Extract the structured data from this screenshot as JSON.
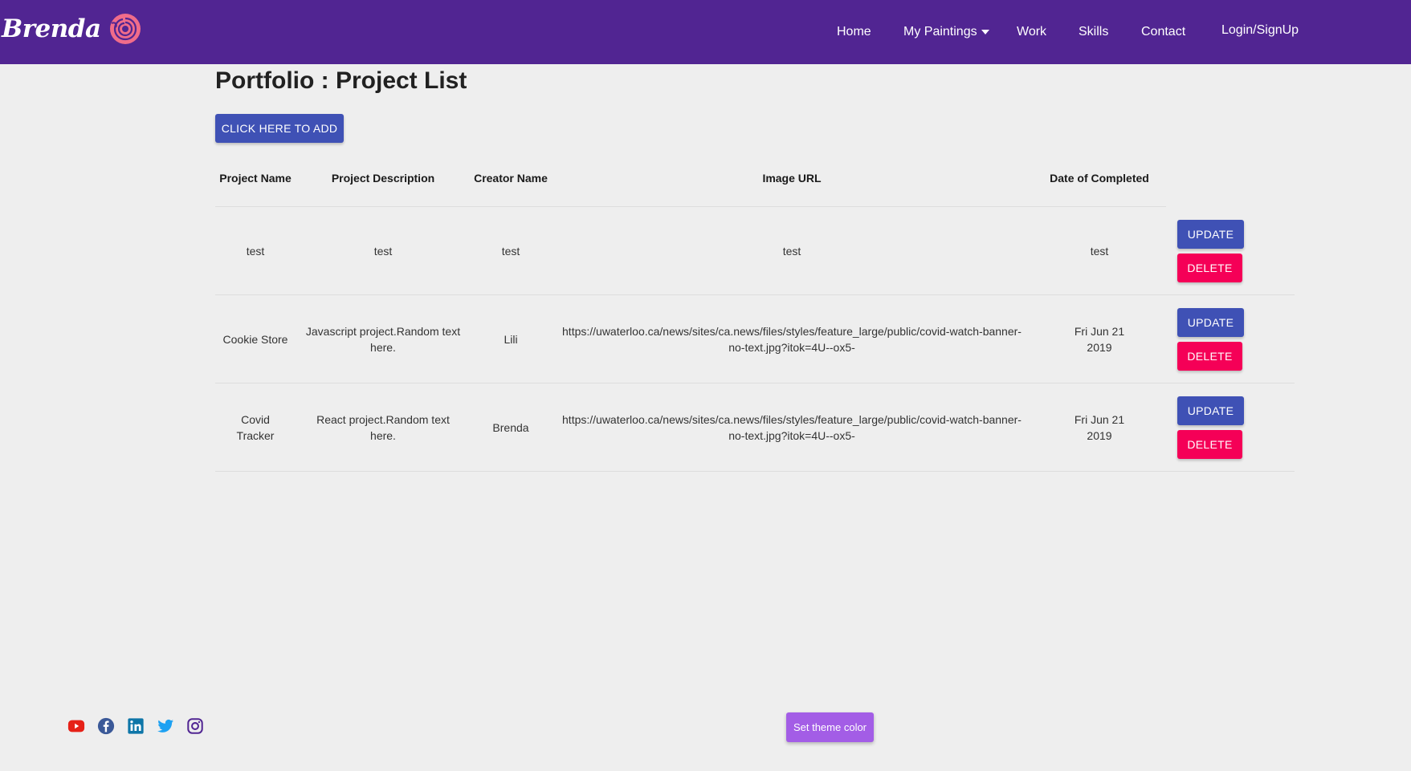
{
  "brand": {
    "name": "Brenda"
  },
  "nav": {
    "home": "Home",
    "paintings": "My Paintings",
    "work": "Work",
    "skills": "Skills",
    "contact": "Contact",
    "login": "Login/SignUp"
  },
  "page": {
    "title": "Portfolio : Project List",
    "add_button": "CLICK HERE TO ADD"
  },
  "table": {
    "headers": {
      "name": "Project Name",
      "description": "Project Description",
      "creator": "Creator Name",
      "image_url": "Image URL",
      "date": "Date of Completed"
    },
    "rows": [
      {
        "name": "test",
        "description": "test",
        "creator": "test",
        "image_url": "test",
        "date": "test",
        "update": "UPDATE",
        "delete": "DELETE"
      },
      {
        "name": "Cookie Store",
        "description": "Javascript project.Random text here.",
        "creator": "Lili",
        "image_url": "https://uwaterloo.ca/news/sites/ca.news/files/styles/feature_large/public/covid-watch-banner-no-text.jpg?itok=4U--ox5-",
        "date": "Fri Jun 21 2019",
        "update": "UPDATE",
        "delete": "DELETE"
      },
      {
        "name": "Covid Tracker",
        "description": "React project.Random text here.",
        "creator": "Brenda",
        "image_url": "https://uwaterloo.ca/news/sites/ca.news/files/styles/feature_large/public/covid-watch-banner-no-text.jpg?itok=4U--ox5-",
        "date": "Fri Jun 21 2019",
        "update": "UPDATE",
        "delete": "DELETE"
      }
    ]
  },
  "footer": {
    "socials": [
      "youtube-icon",
      "facebook-icon",
      "linkedin-icon",
      "twitter-icon",
      "instagram-icon"
    ],
    "theme_button": "Set theme color"
  },
  "colors": {
    "navbar": "#512592",
    "primary": "#3f51b5",
    "danger": "#f50057",
    "theme_button": "#a35de6",
    "logo": "#f06c8a",
    "background": "#eeeeee"
  }
}
